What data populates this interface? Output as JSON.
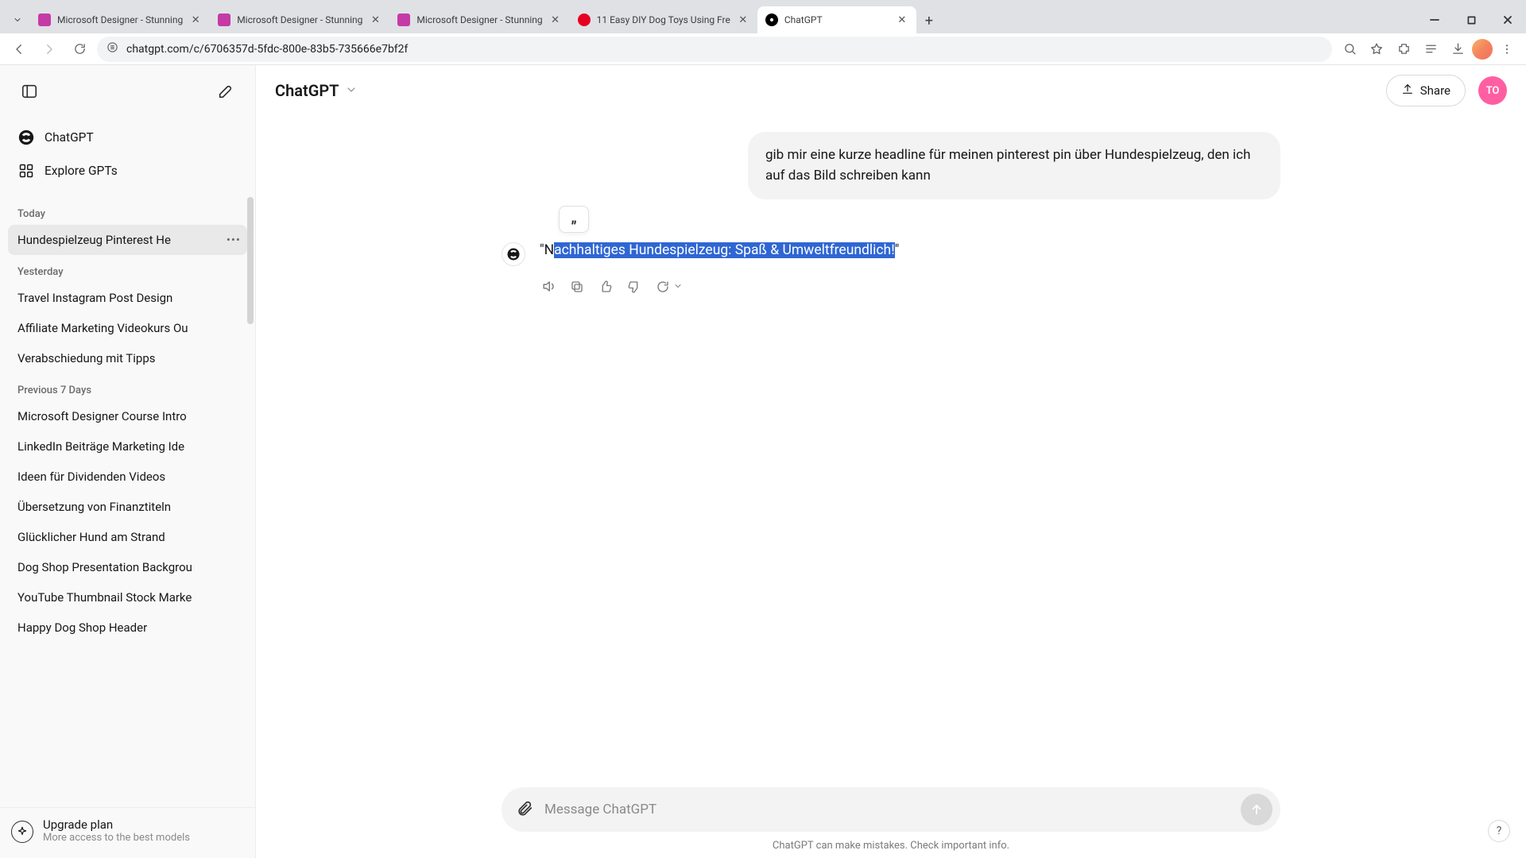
{
  "browser": {
    "tabs": [
      {
        "title": "Microsoft Designer - Stunning",
        "fav": "designer"
      },
      {
        "title": "Microsoft Designer - Stunning",
        "fav": "designer"
      },
      {
        "title": "Microsoft Designer - Stunning",
        "fav": "designer"
      },
      {
        "title": "11 Easy DIY Dog Toys Using Fre",
        "fav": "pin"
      },
      {
        "title": "ChatGPT",
        "fav": "cg",
        "active": true
      }
    ],
    "url": "chatgpt.com/c/6706357d-5fdc-800e-83b5-735666e7bf2f"
  },
  "header": {
    "model_label": "ChatGPT",
    "share_label": "Share",
    "avatar_initials": "TO"
  },
  "sidebar": {
    "chatgpt_label": "ChatGPT",
    "explore_label": "Explore GPTs",
    "sections": [
      {
        "label": "Today",
        "items": [
          {
            "title": "Hundespielzeug Pinterest He",
            "active": true
          }
        ]
      },
      {
        "label": "Yesterday",
        "items": [
          {
            "title": "Travel Instagram Post Design"
          },
          {
            "title": "Affiliate Marketing Videokurs Ou"
          },
          {
            "title": "Verabschiedung mit Tipps"
          }
        ]
      },
      {
        "label": "Previous 7 Days",
        "items": [
          {
            "title": "Microsoft Designer Course Intro"
          },
          {
            "title": "LinkedIn Beiträge Marketing Ide"
          },
          {
            "title": "Ideen für Dividenden Videos"
          },
          {
            "title": "Übersetzung von Finanztiteln"
          },
          {
            "title": "Glücklicher Hund am Strand"
          },
          {
            "title": "Dog Shop Presentation Backgrou"
          },
          {
            "title": "YouTube Thumbnail Stock Marke"
          },
          {
            "title": "Happy Dog Shop Header"
          }
        ]
      }
    ],
    "upgrade_title": "Upgrade plan",
    "upgrade_sub": "More access to the best models"
  },
  "conversation": {
    "user_message": "gib mir eine kurze headline für meinen pinterest pin über Hundespielzeug, den ich auf das Bild schreiben kann",
    "assistant_prefix_quote": "\"",
    "assistant_prefix_char": "N",
    "assistant_selected": "achhaltiges Hundespielzeug: Spaß & Umweltfreundlich!",
    "assistant_suffix_quote": "\"",
    "quote_tooltip_glyph": "„"
  },
  "composer": {
    "placeholder": "Message ChatGPT",
    "disclaimer": "ChatGPT can make mistakes. Check important info."
  },
  "help_glyph": "?"
}
